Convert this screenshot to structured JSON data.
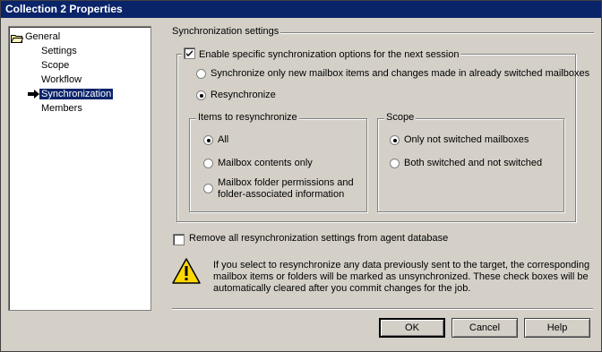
{
  "window": {
    "title": "Collection 2 Properties"
  },
  "tree": {
    "root": "General",
    "items": [
      "Settings",
      "Scope",
      "Workflow",
      "Synchronization",
      "Members"
    ],
    "selected": "Synchronization"
  },
  "section_title": "Synchronization settings",
  "enable_option": {
    "label": "Enable specific synchronization options for the next session",
    "checked": true
  },
  "mode_options": [
    {
      "label": "Synchronize only new mailbox items and changes made in already switched mailboxes",
      "selected": false
    },
    {
      "label": "Resynchronize",
      "selected": true
    }
  ],
  "items_group": {
    "title": "Items to resynchronize",
    "options": [
      {
        "label": "All",
        "selected": true
      },
      {
        "label": "Mailbox contents only",
        "selected": false
      },
      {
        "label_line1": "Mailbox folder permissions and",
        "label_line2": "folder-associated information",
        "selected": false
      }
    ]
  },
  "scope_group": {
    "title": "Scope",
    "options": [
      {
        "label": "Only not switched mailboxes",
        "selected": true
      },
      {
        "label": "Both switched and not switched",
        "selected": false
      }
    ]
  },
  "remove_option": {
    "label": "Remove all resynchronization settings from agent database",
    "checked": false
  },
  "warning_text": "If you select to resynchronize any data previously sent to the target, the corresponding mailbox items or folders will be marked as unsynchronized. These check boxes will be automatically cleared after you commit changes for the job.",
  "buttons": {
    "ok": "OK",
    "cancel": "Cancel",
    "help": "Help"
  }
}
